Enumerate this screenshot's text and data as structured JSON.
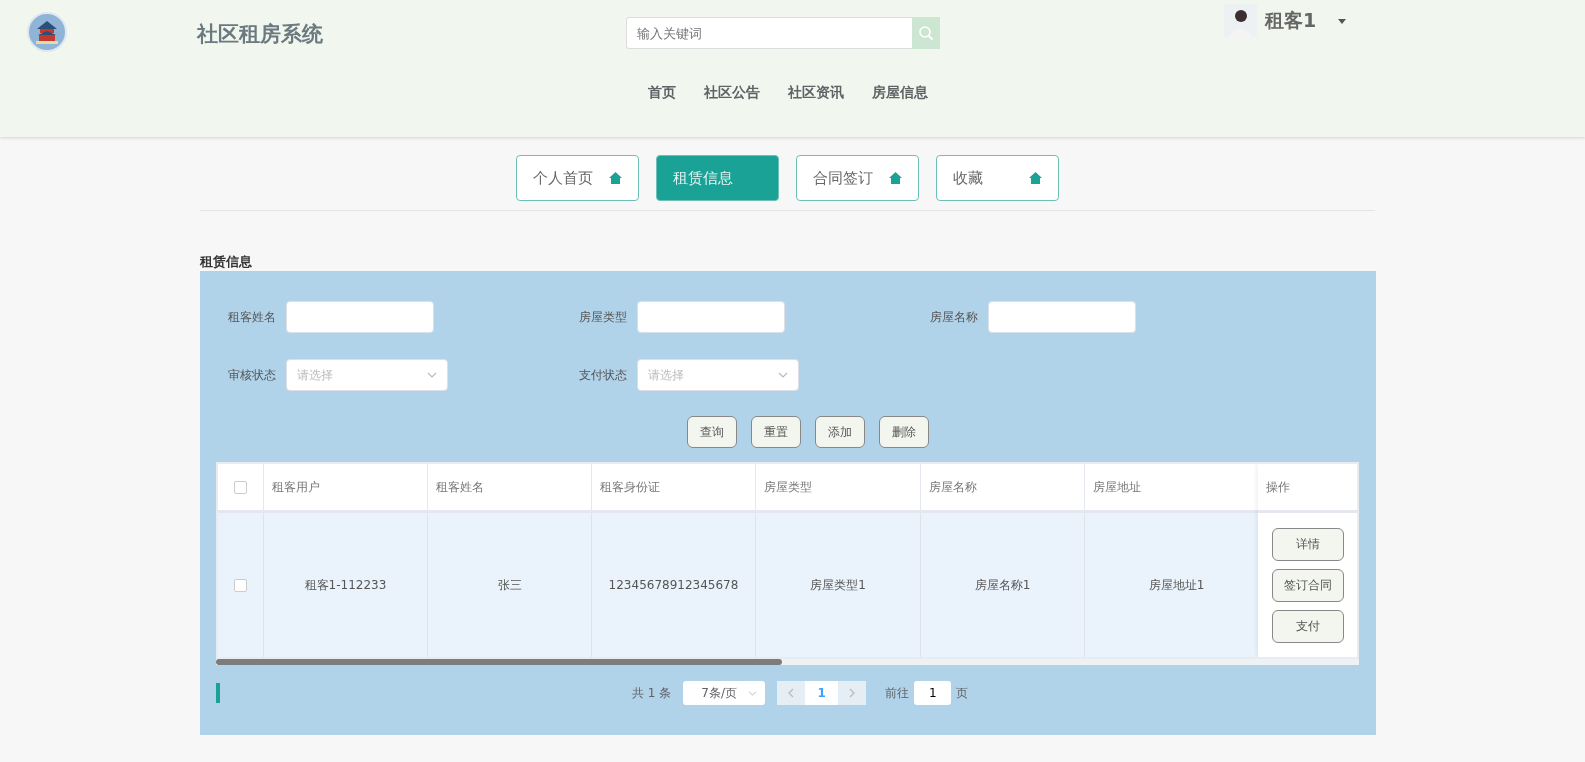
{
  "header": {
    "title": "社区租房系统",
    "search": {
      "placeholder": "输入关键词"
    },
    "user": {
      "name": "租客1"
    },
    "nav": [
      {
        "label": "首页"
      },
      {
        "label": "社区公告"
      },
      {
        "label": "社区资讯"
      },
      {
        "label": "房屋信息"
      }
    ]
  },
  "tabs": [
    {
      "label": "个人首页",
      "selected": false
    },
    {
      "label": "租赁信息",
      "selected": true
    },
    {
      "label": "合同签订",
      "selected": false
    },
    {
      "label": "收藏",
      "selected": false
    }
  ],
  "section_title": "租赁信息",
  "filters": [
    {
      "kind": "input",
      "label": "租客姓名"
    },
    {
      "kind": "input",
      "label": "房屋类型"
    },
    {
      "kind": "input",
      "label": "房屋名称"
    },
    {
      "kind": "select",
      "label": "审核状态",
      "placeholder": "请选择"
    },
    {
      "kind": "select",
      "label": "支付状态",
      "placeholder": "请选择"
    }
  ],
  "actions": [
    "查询",
    "重置",
    "添加",
    "删除"
  ],
  "table": {
    "select_all_checked": false,
    "columns": [
      "租客用户",
      "租客姓名",
      "租客身份证",
      "房屋类型",
      "房屋名称",
      "房屋地址"
    ],
    "action_column": "操作",
    "rows": [
      {
        "checked": false,
        "cells": [
          "租客1-112233",
          "张三",
          "12345678912345678",
          "房屋类型1",
          "房屋名称1",
          "房屋地址1"
        ],
        "buttons": [
          "详情",
          "签订合同",
          "支付"
        ]
      }
    ]
  },
  "pagination": {
    "total": "共 1 条",
    "page_size": "7条/页",
    "pages": [
      {
        "label": "1",
        "selected": true
      }
    ],
    "goto_label": "前往",
    "goto_value": "1",
    "page_suffix": "页"
  }
}
